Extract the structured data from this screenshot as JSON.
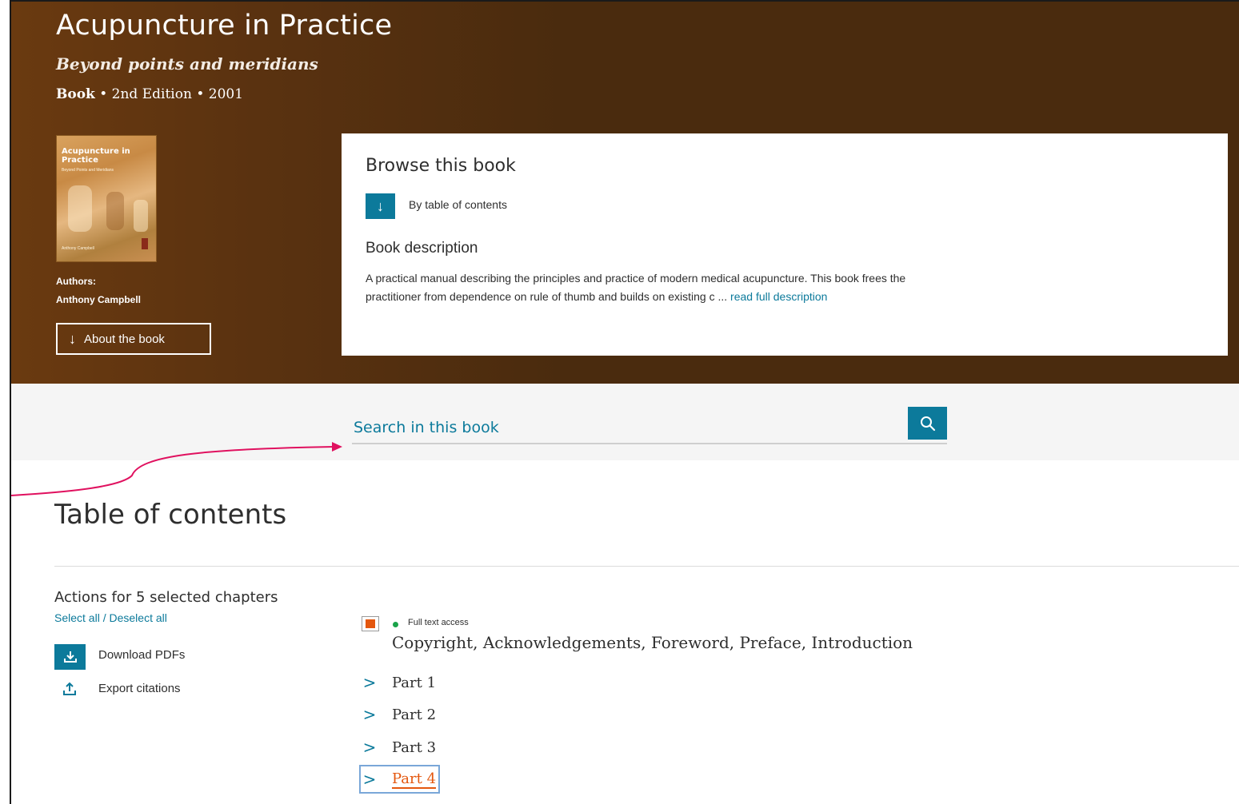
{
  "book": {
    "title": "Acupuncture in Practice",
    "subtitle": "Beyond points and meridians",
    "type": "Book",
    "edition": "2nd Edition",
    "year": "2001",
    "cover": {
      "title": "Acupuncture in Practice",
      "subtitle": "Beyond Points and Meridians",
      "author": "Anthony Campbell"
    },
    "authors_label": "Authors:",
    "authors": "Anthony Campbell",
    "about_button": "About the book"
  },
  "browse": {
    "heading": "Browse this book",
    "toc_link": "By table of contents",
    "description_heading": "Book description",
    "description": "A practical manual describing the principles and practice of modern medical acupuncture. This book frees the practitioner from dependence on rule of thumb and builds on existing c ...",
    "read_more": "read full description"
  },
  "search": {
    "placeholder": "Search in this book"
  },
  "toc": {
    "title": "Table of contents",
    "actions_heading": "Actions for 5 selected chapters",
    "select_all": "Select all",
    "separator": " / ",
    "deselect_all": "Deselect all",
    "download_label": "Download PDFs",
    "export_label": "Export citations",
    "chapter": {
      "access": "Full text access",
      "title": "Copyright, Acknowledgements, Foreword, Preface, Introduction"
    },
    "parts": [
      "Part 1",
      "Part 2",
      "Part 3",
      "Part 4"
    ]
  },
  "colors": {
    "accent": "#0c7a9b",
    "header_brown": "#4a2b0e",
    "highlight_orange": "#e4570e",
    "annotation_arrow": "#e0115f",
    "access_green": "#1aa34a"
  }
}
